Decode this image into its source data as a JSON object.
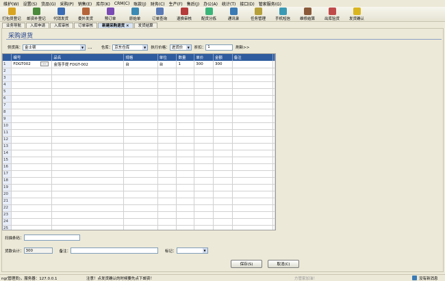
{
  "menu": [
    "维护(W)",
    "设置(S)",
    "货品(G)",
    "采购(P)",
    "销售(E)",
    "库存(K)",
    "CRM(C)",
    "账款(J)",
    "财务(C)",
    "生产(F)",
    "售后(J)",
    "办公(A)",
    "统计(T)",
    "接口(D)",
    "管家服务(G)"
  ],
  "toolbar": [
    {
      "label": "打包员登记",
      "icon": "box-icon",
      "color": "#d9a520"
    },
    {
      "label": "邮资补登记",
      "icon": "stamp-icon",
      "color": "#4a8a3a"
    },
    {
      "label": "代销发货",
      "icon": "truck-icon",
      "color": "#3a6cb5"
    },
    {
      "label": "委外发货",
      "icon": "delivery-icon",
      "color": "#b5653a"
    },
    {
      "label": "预订单",
      "icon": "order-icon",
      "color": "#7a4ab5"
    },
    {
      "label": "原始单",
      "icon": "document-icon",
      "color": "#3a8ab5"
    },
    {
      "label": "订单查询",
      "icon": "search-icon",
      "color": "#5a7ab5"
    },
    {
      "label": "退换审核",
      "icon": "return-icon",
      "color": "#b53a3a"
    },
    {
      "label": "配货分拣",
      "icon": "sort-icon",
      "color": "#3ab57a"
    },
    {
      "label": "通讯录",
      "icon": "contacts-icon",
      "color": "#3a7ab5"
    },
    {
      "label": "任务管理",
      "icon": "task-icon",
      "color": "#b5a03a"
    },
    {
      "label": "手机短信",
      "icon": "sms-icon",
      "color": "#3a9ab5"
    },
    {
      "label": "维修结算",
      "icon": "repair-icon",
      "color": "#8a5a3a"
    },
    {
      "label": "出库验货",
      "icon": "inspect-icon",
      "color": "#c04a4a"
    },
    {
      "label": "发货确认",
      "icon": "confirm-icon",
      "color": "#d9b520"
    }
  ],
  "tabs": [
    {
      "label": "业务导航",
      "active": false
    },
    {
      "label": "入库申请",
      "active": false
    },
    {
      "label": "入库审核",
      "active": false
    },
    {
      "label": "订单审核",
      "active": false
    },
    {
      "label": "新建采购退货 ×",
      "active": true
    },
    {
      "label": "发货结算",
      "active": false
    }
  ],
  "page": {
    "title": "采购退货",
    "supplier_label": "供货商：",
    "supplier_value": "金士顿",
    "supplier_more": "...",
    "warehouse_label": "仓库：",
    "warehouse_value": "京东仓库",
    "price_label": "执行价格：",
    "price_value": "进货价",
    "discount_label": "折扣：",
    "discount_value": "1",
    "refresh_label": "刷新>>"
  },
  "grid": {
    "columns": [
      "编号",
      "品名",
      "规格",
      "单位",
      "数量",
      "单价",
      "金额",
      "备注"
    ],
    "rows": [
      {
        "no": "1",
        "code": "FDGT002",
        "name": "金箔手提 FDGT-002",
        "spec": "台",
        "unit": "台",
        "qty": "1",
        "price": "300",
        "amount": "300",
        "remark": ""
      }
    ],
    "row_numbers": [
      "2",
      "3",
      "4",
      "5",
      "6",
      "7",
      "8",
      "9",
      "10",
      "11",
      "12",
      "13",
      "14",
      "15",
      "16",
      "17",
      "18",
      "19",
      "20",
      "21",
      "22",
      "23",
      "24",
      "25"
    ]
  },
  "form": {
    "scan_label": "扫描条码：",
    "scan_value": "",
    "total_label": "货款合计：",
    "total_value": "300",
    "remark_label": "备注：",
    "remark_value": "",
    "mark_label": "标记：",
    "mark_value": "",
    "save_label": "保存(S)",
    "cancel_label": "取消(C)"
  },
  "status": {
    "left": "ng(管理员)，服务器：127.0.0.1",
    "middle": "注意！点发货确认的时候要先点下邮资！",
    "brand": "方管家加油！",
    "right": "没有新消息"
  }
}
